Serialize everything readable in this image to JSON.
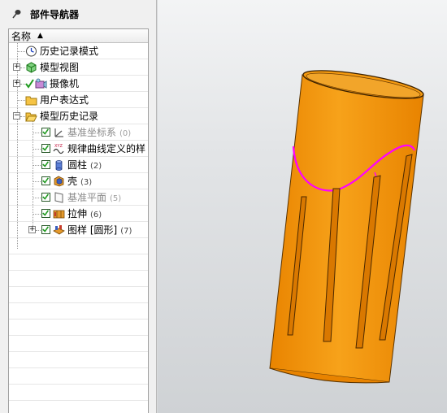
{
  "navigator": {
    "title": "部件导航器",
    "column_header": "名称",
    "items": [
      {
        "label": "历史记录模式",
        "count": ""
      },
      {
        "label": "模型视图",
        "count": ""
      },
      {
        "label": "摄像机",
        "count": ""
      },
      {
        "label": "用户表达式",
        "count": ""
      },
      {
        "label": "模型历史记录",
        "count": ""
      },
      {
        "label": "基准坐标系",
        "count": "(0)"
      },
      {
        "label": "规律曲线定义的样",
        "count": ""
      },
      {
        "label": "圆柱",
        "count": "(2)"
      },
      {
        "label": "壳",
        "count": "(3)"
      },
      {
        "label": "基准平面",
        "count": "(5)"
      },
      {
        "label": "拉伸",
        "count": "(6)"
      },
      {
        "label": "图样 [圆形]",
        "count": "(7)"
      }
    ]
  },
  "colors": {
    "cylinder": "#f59200",
    "curve": "#ff00ff",
    "checkbox": "#1f9a1f"
  }
}
